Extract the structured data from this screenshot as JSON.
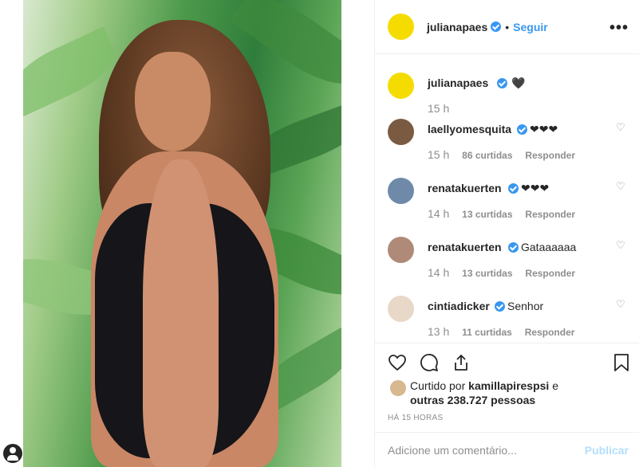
{
  "post": {
    "author": "julianapaes",
    "separator": "•",
    "follow_label": "Seguir",
    "more_label": "•••",
    "photo_alt": "Juliana Paes photo"
  },
  "caption": {
    "user": "julianapaes",
    "text": "🖤",
    "time": "15 h"
  },
  "comments": [
    {
      "user": "laellyomesquita",
      "text": "❤❤❤",
      "time": "15 h",
      "likes": "86 curtidas",
      "reply": "Responder",
      "avatar_color": "#7a5a40"
    },
    {
      "user": "renatakuerten",
      "text": "❤❤❤",
      "time": "14 h",
      "likes": "13 curtidas",
      "reply": "Responder",
      "avatar_color": "#6f8aa8"
    },
    {
      "user": "renatakuerten",
      "text": "Gataaaaaa",
      "time": "14 h",
      "likes": "13 curtidas",
      "reply": "Responder",
      "avatar_color": "#b08a78"
    },
    {
      "user": "cintiadicker",
      "text": "Senhor",
      "time": "13 h",
      "likes": "11 curtidas",
      "reply": "Responder",
      "avatar_color": "#e8d8c8"
    }
  ],
  "actions": {
    "like_icon": "heart-icon",
    "comment_icon": "comment-icon",
    "share_icon": "share-icon",
    "save_icon": "bookmark-icon"
  },
  "liked_by": {
    "prefix": "Curtido por",
    "user": "kamillapirespsi",
    "suffix": "e",
    "others": "outras 238.727 pessoas"
  },
  "time_ago": "HÁ 15 HORAS",
  "add_comment": {
    "placeholder": "Adicione um comentário...",
    "publish_label": "Publicar"
  },
  "colors": {
    "accent": "#3897f0",
    "heart": "#ed2d3d",
    "muted": "#8e8e8e",
    "publish_disabled": "#b2dffc"
  }
}
